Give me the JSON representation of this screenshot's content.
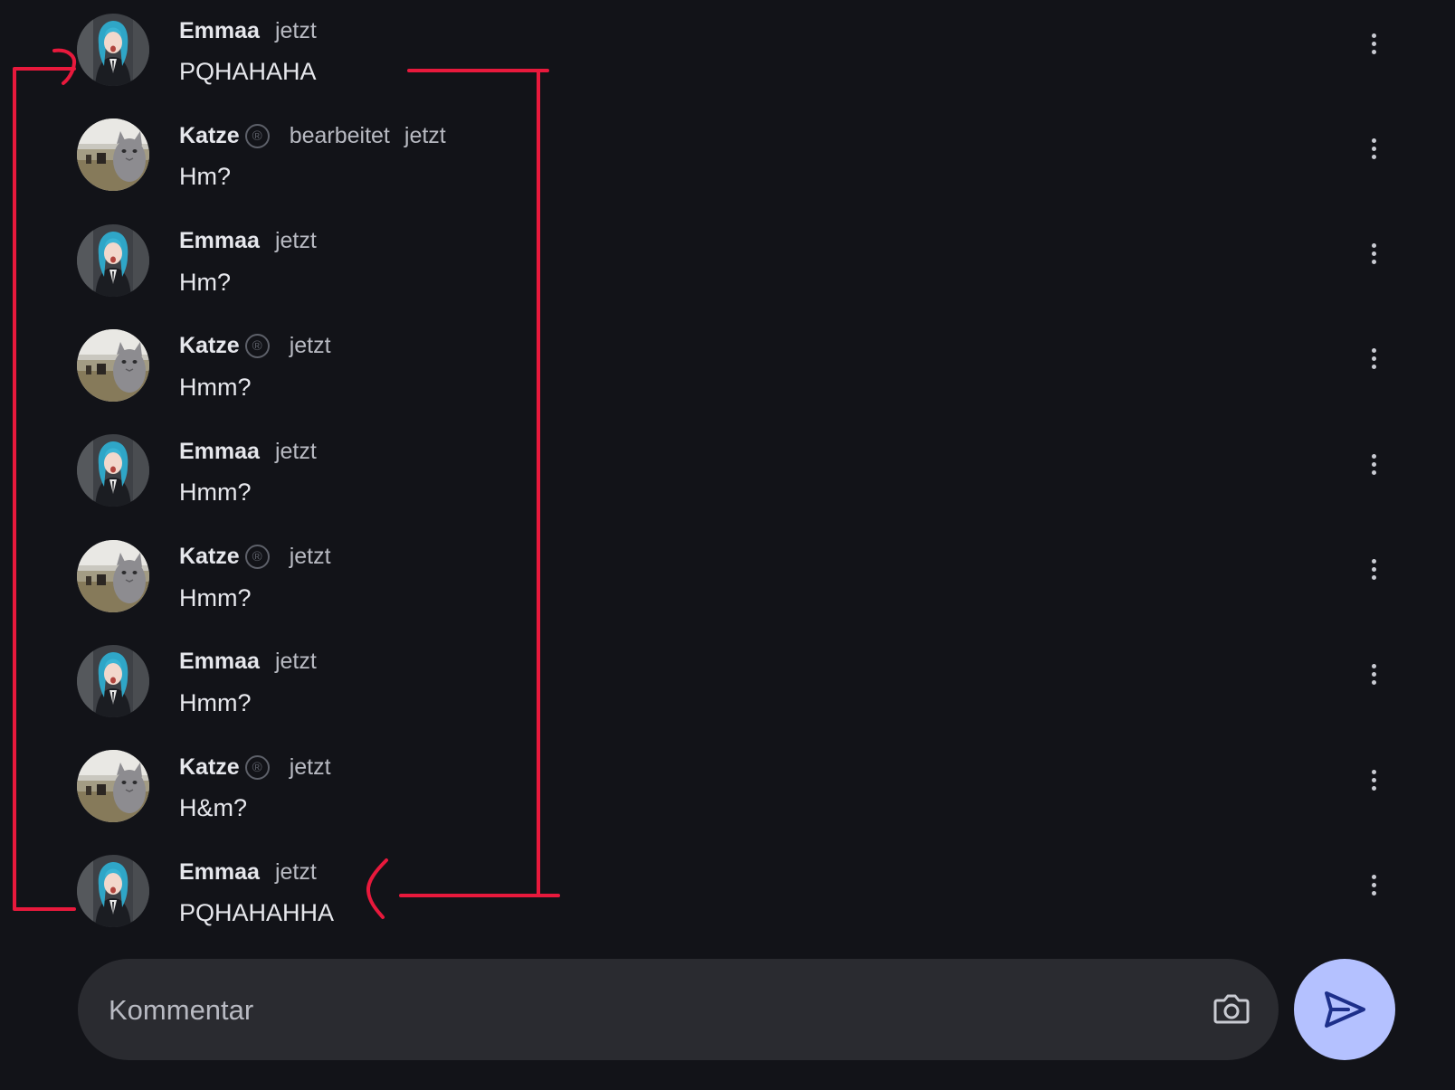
{
  "comments": [
    {
      "author": "Emmaa",
      "verified": false,
      "edited": "",
      "time": "jetzt",
      "text": "PQHAHAHA",
      "avatar": "anime-avatar"
    },
    {
      "author": "Katze",
      "verified": true,
      "edited": "bearbeitet",
      "time": "jetzt",
      "text": "Hm?",
      "avatar": "cat-avatar"
    },
    {
      "author": "Emmaa",
      "verified": false,
      "edited": "",
      "time": "jetzt",
      "text": "Hm?",
      "avatar": "anime-avatar"
    },
    {
      "author": "Katze",
      "verified": true,
      "edited": "",
      "time": "jetzt",
      "text": "Hmm?",
      "avatar": "cat-avatar"
    },
    {
      "author": "Emmaa",
      "verified": false,
      "edited": "",
      "time": "jetzt",
      "text": "Hmm?",
      "avatar": "anime-avatar"
    },
    {
      "author": "Katze",
      "verified": true,
      "edited": "",
      "time": "jetzt",
      "text": "Hmm?",
      "avatar": "cat-avatar"
    },
    {
      "author": "Emmaa",
      "verified": false,
      "edited": "",
      "time": "jetzt",
      "text": "Hmm?",
      "avatar": "anime-avatar"
    },
    {
      "author": "Katze",
      "verified": true,
      "edited": "",
      "time": "jetzt",
      "text": "H&m?",
      "avatar": "cat-avatar"
    },
    {
      "author": "Emmaa",
      "verified": false,
      "edited": "",
      "time": "jetzt",
      "text": "PQHAHAHHA",
      "avatar": "anime-avatar"
    }
  ],
  "verified_badge": "®",
  "comment_input": {
    "placeholder": "Kommentar",
    "value": ""
  },
  "icons": {
    "camera": "camera-icon",
    "send": "send-icon",
    "more": "more-vert-icon"
  },
  "colors": {
    "background": "#121318",
    "send_button": "#b4c1ff",
    "annotation": "#e8193c"
  }
}
